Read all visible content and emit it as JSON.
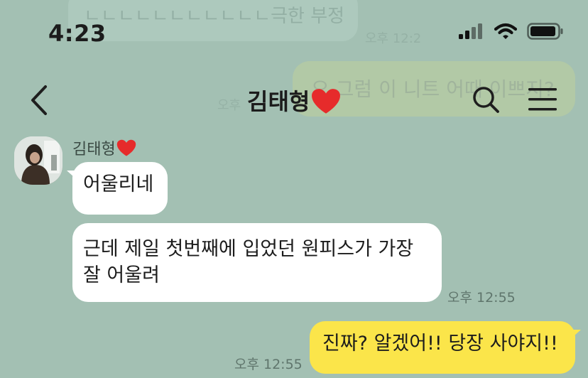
{
  "status_bar": {
    "time": "4:23"
  },
  "header": {
    "title": "김태형",
    "title_emoji": "❤️"
  },
  "background_ghost": {
    "top_message": "ㄴㄴㄴㄴㄴㄴㄴㄴㄴㄴㄴ극한 부정",
    "top_time": "오후 12:2",
    "mid_message": "오 그럼 이 니트 어때 이쁘지?",
    "mid_time": "오후"
  },
  "messages": {
    "sender_name": "김태형",
    "sender_emoji": "❤️",
    "incoming": [
      {
        "text": "어울리네"
      },
      {
        "text": "근데 제일 첫번째에 입었던 원피스가 가장 잘 어울려",
        "time": "오후 12:55"
      }
    ],
    "outgoing": [
      {
        "text": "진짜? 알겠어!! 당장 사야지!!",
        "time": "오후 12:55"
      }
    ]
  },
  "colors": {
    "background": "#a3c0b3",
    "incoming_bubble": "#ffffff",
    "outgoing_bubble": "#fbe54a"
  },
  "icons": [
    "back-arrow-icon",
    "search-icon",
    "menu-icon",
    "signal-icon",
    "wifi-icon",
    "battery-icon",
    "heart-icon"
  ]
}
